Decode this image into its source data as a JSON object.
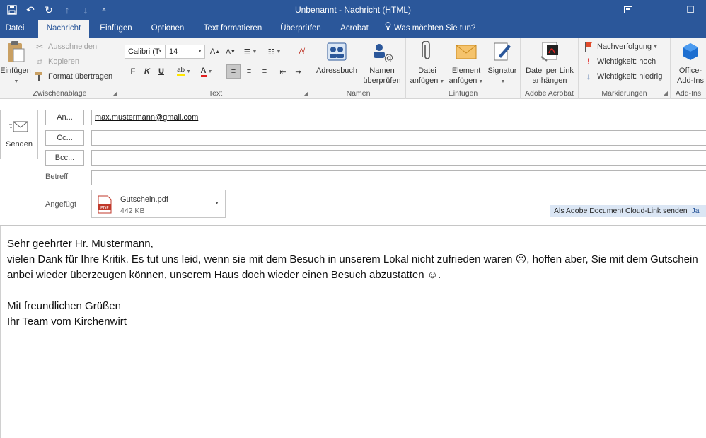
{
  "window": {
    "title": "Unbenannt - Nachricht (HTML)"
  },
  "tabs": [
    {
      "label": "Datei"
    },
    {
      "label": "Nachricht"
    },
    {
      "label": "Einfügen"
    },
    {
      "label": "Optionen"
    },
    {
      "label": "Text formatieren"
    },
    {
      "label": "Überprüfen"
    },
    {
      "label": "Acrobat"
    },
    {
      "label": "Was möchten Sie tun?"
    }
  ],
  "ribbon": {
    "clipboard": {
      "label": "Zwischenablage",
      "paste": "Einfügen",
      "cut": "Ausschneiden",
      "copy": "Kopieren",
      "format_painter": "Format übertragen"
    },
    "text": {
      "label": "Text",
      "font": "Calibri (T",
      "size": "14",
      "bold": "F",
      "italic": "K",
      "underline": "U"
    },
    "names": {
      "label": "Namen",
      "address_book": "Adressbuch",
      "check_names_1": "Namen",
      "check_names_2": "überprüfen"
    },
    "include": {
      "label": "Einfügen",
      "attach_file_1": "Datei",
      "attach_file_2": "anfügen",
      "attach_item_1": "Element",
      "attach_item_2": "anfügen",
      "signature": "Signatur"
    },
    "acrobat": {
      "label": "Adobe Acrobat",
      "attach_link_1": "Datei per Link",
      "attach_link_2": "anhängen"
    },
    "tags": {
      "label": "Markierungen",
      "followup": "Nachverfolgung",
      "high": "Wichtigkeit: hoch",
      "low": "Wichtigkeit: niedrig"
    },
    "addins": {
      "label": "Add-Ins",
      "office_1": "Office-",
      "office_2": "Add-Ins"
    }
  },
  "compose": {
    "send": "Senden",
    "to_button": "An...",
    "cc_button": "Cc...",
    "bcc_button": "Bcc...",
    "subject_label": "Betreff",
    "attached_label": "Angefügt",
    "to_value": "max.mustermann@gmail.com",
    "cc_value": "",
    "bcc_value": "",
    "subject_value": "",
    "attachment": {
      "name": "Gutschein.pdf",
      "size": "442 KB"
    },
    "cloud_link": "Als Adobe Document Cloud-Link senden",
    "cloud_yes": "Ja"
  },
  "body": {
    "lines": [
      "Sehr geehrter Hr. Mustermann,",
      "vielen Dank für Ihre Kritik. Es tut uns leid, wenn sie mit dem Besuch in unserem Lokal nicht zufrieden waren ☹, hoffen aber, Sie mit dem Gutschein anbei wieder überzeugen können, unserem Haus doch wieder einen Besuch abzustatten ☺.",
      "",
      "Mit freundlichen Grüßen",
      "Ihr Team vom Kirchenwirt"
    ]
  }
}
